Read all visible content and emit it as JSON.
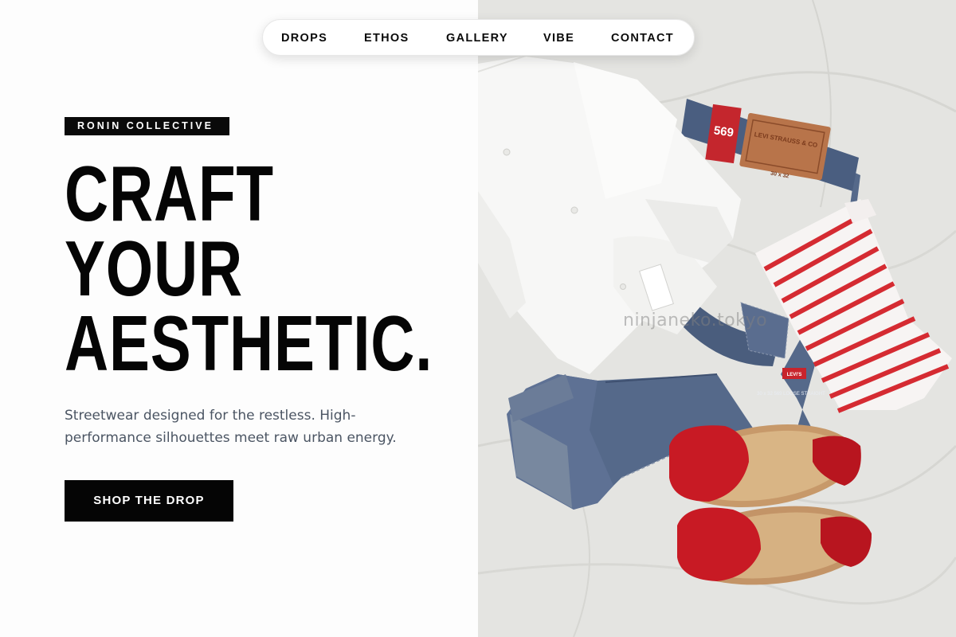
{
  "nav": {
    "items": [
      {
        "label": "DROPS"
      },
      {
        "label": "ETHOS"
      },
      {
        "label": "GALLERY"
      },
      {
        "label": "VIBE"
      },
      {
        "label": "CONTACT"
      }
    ]
  },
  "hero": {
    "brand": "RONIN COLLECTIVE",
    "headline_lines": [
      "CRAFT",
      "YOUR",
      "AESTHETIC."
    ],
    "description": "Streetwear designed for the restless. High-performance silhouettes meet raw urban energy.",
    "cta_label": "SHOP THE DROP"
  },
  "image": {
    "watermark": "ninjaneko.tokyo",
    "jeans_patch_text": "LEVI STRAUSS & CO",
    "jeans_tag_number": "569",
    "jeans_size": "30 x 32",
    "jeans_label_small": "LEVI'S",
    "jeans_label_detail": "30 x 32 569 LOOSE STRAIGHT"
  },
  "colors": {
    "accent": "#050505",
    "text_muted": "#4b5563",
    "denim": "#4f6380",
    "stripe_red": "#d52b32",
    "sandal_red": "#c81a24"
  }
}
